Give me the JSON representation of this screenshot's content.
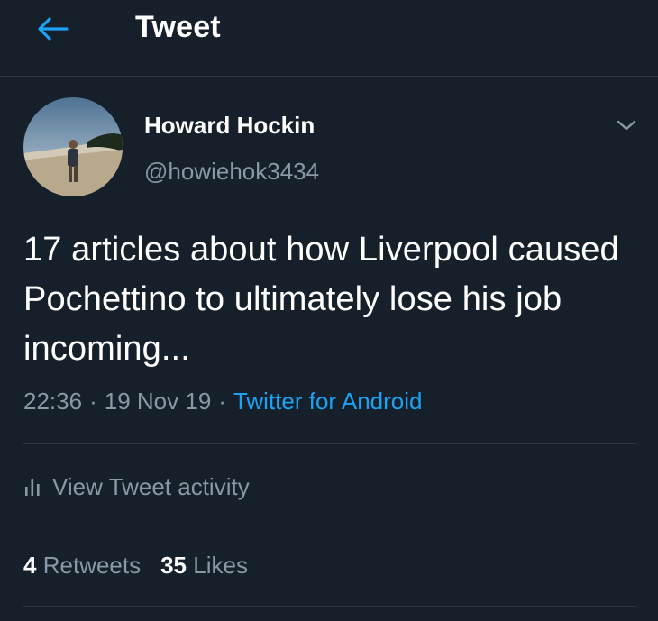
{
  "header": {
    "title": "Tweet",
    "back_icon": "arrow-left-icon"
  },
  "colors": {
    "background": "#15202b",
    "accent": "#1da1f2",
    "secondary_text": "#8899a6",
    "divider": "#2b3640"
  },
  "tweet": {
    "author": {
      "name": "Howard Hockin",
      "handle": "@howiehok3434"
    },
    "text": "17 articles about how Liverpool caused Pochettino to ultimately lose his job incoming...",
    "time": "22:36",
    "separator": "·",
    "date": "19 Nov 19",
    "source": "Twitter for Android",
    "activity_label": "View Tweet activity",
    "activity_icon": "bar-chart-icon",
    "more_icon": "chevron-down-icon",
    "stats": {
      "retweets_count": "4",
      "retweets_label": "Retweets",
      "likes_count": "35",
      "likes_label": "Likes"
    }
  }
}
